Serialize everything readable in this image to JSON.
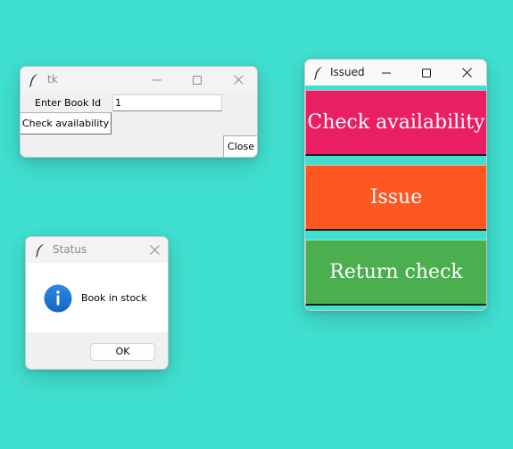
{
  "tk_window": {
    "title": "tk",
    "book_id_label": "Enter Book Id",
    "book_id_value": "1",
    "check_button": "Check availability",
    "close_button": "Close"
  },
  "status_dialog": {
    "title": "Status",
    "icon": "info-icon",
    "message": "Book in stock",
    "ok_button": "OK"
  },
  "issued_window": {
    "title": "Issued",
    "buttons": [
      {
        "label": "Check availability",
        "color": "#ea1e63"
      },
      {
        "label": "Issue",
        "color": "#fe5721"
      },
      {
        "label": "Return check",
        "color": "#4bae4f"
      }
    ]
  },
  "colors": {
    "desktop_bg": "#40e0d0",
    "info_blue": "#1976d2"
  },
  "icons": {
    "window_icon": "feather-icon",
    "minimize": "minimize-icon",
    "maximize": "maximize-icon",
    "close": "close-icon"
  }
}
